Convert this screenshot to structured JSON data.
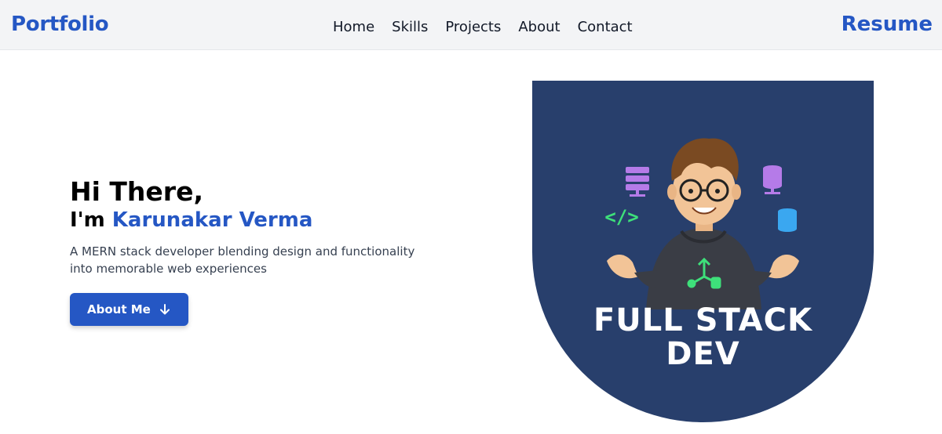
{
  "header": {
    "logo": "Portfolio",
    "nav": [
      "Home",
      "Skills",
      "Projects",
      "About",
      "Contact"
    ],
    "resume": "Resume"
  },
  "hero": {
    "greeting": "Hi There,",
    "intro_prefix": "I'm ",
    "name": "Karunakar Verma",
    "tagline": "A MERN stack developer blending design and functionality into memorable web experiences",
    "button_label": "About Me",
    "button_icon": "arrow-down-icon"
  },
  "hero_image": {
    "line1": "FULL STACK",
    "line2": "DEV",
    "code_tag": "</>"
  },
  "colors": {
    "accent": "#2557c4",
    "header_bg": "#f3f4f6",
    "image_bg": "#283f6c"
  }
}
